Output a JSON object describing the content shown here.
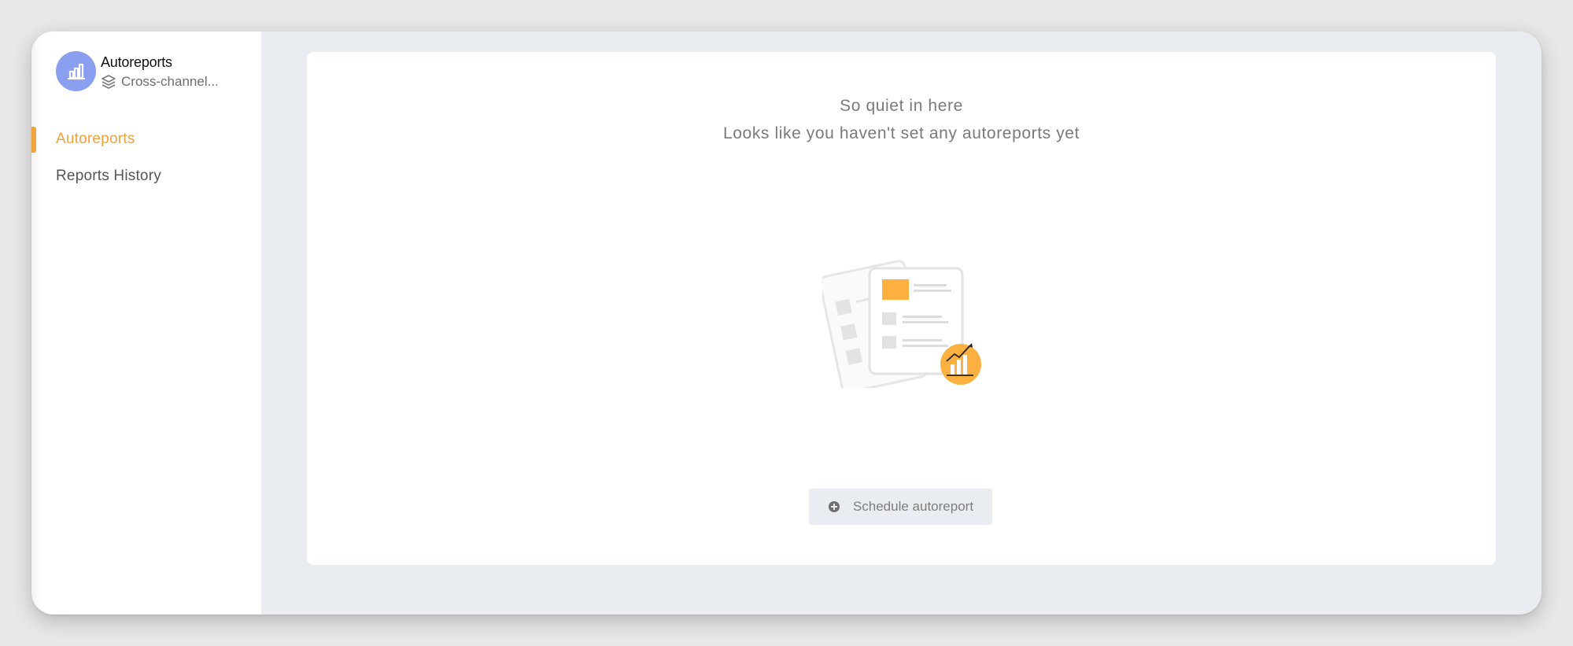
{
  "app": {
    "title": "Autoreports",
    "workspace": "Cross-channel...",
    "logo_icon": "bar-chart-icon",
    "workspace_icon": "layers-icon"
  },
  "nav": {
    "items": [
      {
        "label": "Autoreports",
        "active": true
      },
      {
        "label": "Reports History",
        "active": false
      }
    ]
  },
  "empty_state": {
    "title": "So quiet in here",
    "subtitle": "Looks like you haven't set any autoreports yet",
    "illustration_icon": "reports-illustration"
  },
  "actions": {
    "schedule_label": "Schedule autoreport",
    "schedule_icon": "plus-circle-icon"
  },
  "colors": {
    "accent": "#f0a23b",
    "logo_bg": "#8a9ff0",
    "illustration_orange": "#fbb040",
    "background": "#e9edf2"
  }
}
